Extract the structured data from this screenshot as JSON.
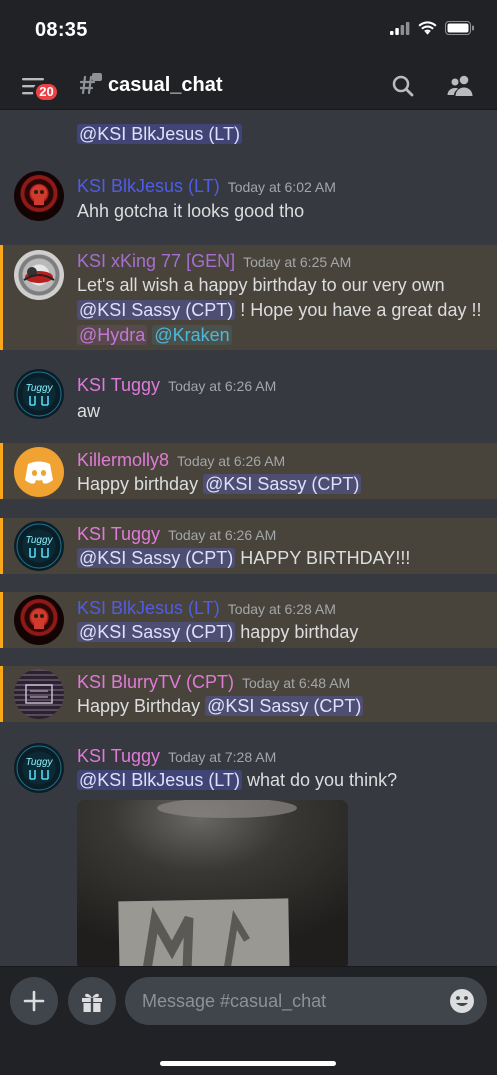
{
  "status_bar": {
    "time": "08:35"
  },
  "header": {
    "channel": "casual_chat",
    "unread_badge": "20"
  },
  "colors": {
    "blue_role": "#4f5ce8",
    "purple_role": "#a56fd0",
    "pink_role": "#e07ad9",
    "mention_accent": "#faa81a"
  },
  "messages": [
    {
      "author": "",
      "time": "",
      "text_prefix": "",
      "mention": "@KSI BlkJesus (LT)",
      "text_suffix": ""
    },
    {
      "author": "KSI BlkJesus (LT)",
      "time": "Today at 6:02 AM",
      "text": "Ahh gotcha it looks good tho"
    },
    {
      "author": "KSI xKing 77 [GEN]",
      "time": "Today at 6:25 AM",
      "line1": "Let's all wish a happy birthday to our very own",
      "mention": "@KSI Sassy (CPT)",
      "line2_suffix": " ! Hope you have a great day !!",
      "mention_hydra": "@Hydra",
      "mention_kraken": "@Kraken"
    },
    {
      "author": "KSI Tuggy",
      "time": "Today at 6:26 AM",
      "text": "aw"
    },
    {
      "author": "Killermolly8",
      "time": "Today at 6:26 AM",
      "text_prefix": "Happy birthday ",
      "mention": "@KSI Sassy (CPT)",
      "text_suffix": ""
    },
    {
      "author": "KSI Tuggy",
      "time": "Today at 6:26 AM",
      "text_prefix": "",
      "mention": "@KSI Sassy (CPT)",
      "text_suffix": " HAPPY BIRTHDAY!!!"
    },
    {
      "author": "KSI BlkJesus (LT)",
      "time": "Today at 6:28 AM",
      "text_prefix": "",
      "mention": "@KSI Sassy (CPT)",
      "text_suffix": " happy birthday"
    },
    {
      "author": "KSI BlurryTV (CPT)",
      "time": "Today at 6:48 AM",
      "text_prefix": "Happy Birthday ",
      "mention": "@KSI Sassy (CPT)",
      "text_suffix": ""
    },
    {
      "author": "KSI Tuggy",
      "time": "Today at 7:28 AM",
      "text_prefix": "",
      "mention": "@KSI BlkJesus (LT)",
      "text_suffix": " what do you think?"
    }
  ],
  "composer": {
    "placeholder": "Message #casual_chat"
  },
  "icons": [
    "signal-icon",
    "wifi-icon",
    "battery-icon",
    "hamburger-icon",
    "threads-channel-icon",
    "search-icon",
    "members-icon",
    "plus-icon",
    "gift-icon",
    "emoji-icon",
    "discord-logo-icon"
  ]
}
